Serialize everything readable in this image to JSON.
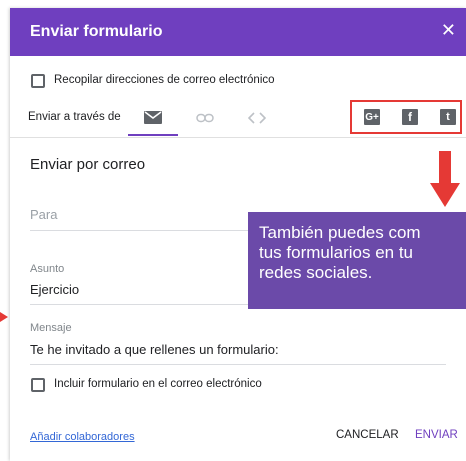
{
  "colors": {
    "accent": "#6f3fbf",
    "highlight": "#e53935",
    "callout": "#6b4aa9"
  },
  "dialog": {
    "title": "Enviar formulario",
    "close_icon": "close-icon"
  },
  "collect_emails": {
    "label": "Recopilar direcciones de correo electrónico",
    "checked": false
  },
  "send_via": {
    "label": "Enviar a través de",
    "tabs": [
      {
        "icon": "mail-icon",
        "active": true
      },
      {
        "icon": "link-icon",
        "active": false
      },
      {
        "icon": "embed-icon",
        "active": false
      }
    ],
    "social": [
      {
        "icon": "google-plus-icon",
        "glyph": "G+"
      },
      {
        "icon": "facebook-icon",
        "glyph": "f"
      },
      {
        "icon": "twitter-icon",
        "glyph": "t"
      }
    ]
  },
  "email": {
    "section_title": "Enviar por correo",
    "to": {
      "placeholder": "Para"
    },
    "subject": {
      "label": "Asunto",
      "value": "Ejercicio"
    },
    "message": {
      "label": "Mensaje",
      "value": "Te he invitado a que rellenes un formulario:"
    },
    "include_form": {
      "label": "Incluir formulario en el correo electrónico",
      "checked": false
    }
  },
  "footer": {
    "add_collaborators": "Añadir colaboradores",
    "cancel": "CANCELAR",
    "send": "ENVIAR"
  },
  "callout": {
    "text": "También puedes com\ntus formularios en tu\nredes sociales."
  }
}
